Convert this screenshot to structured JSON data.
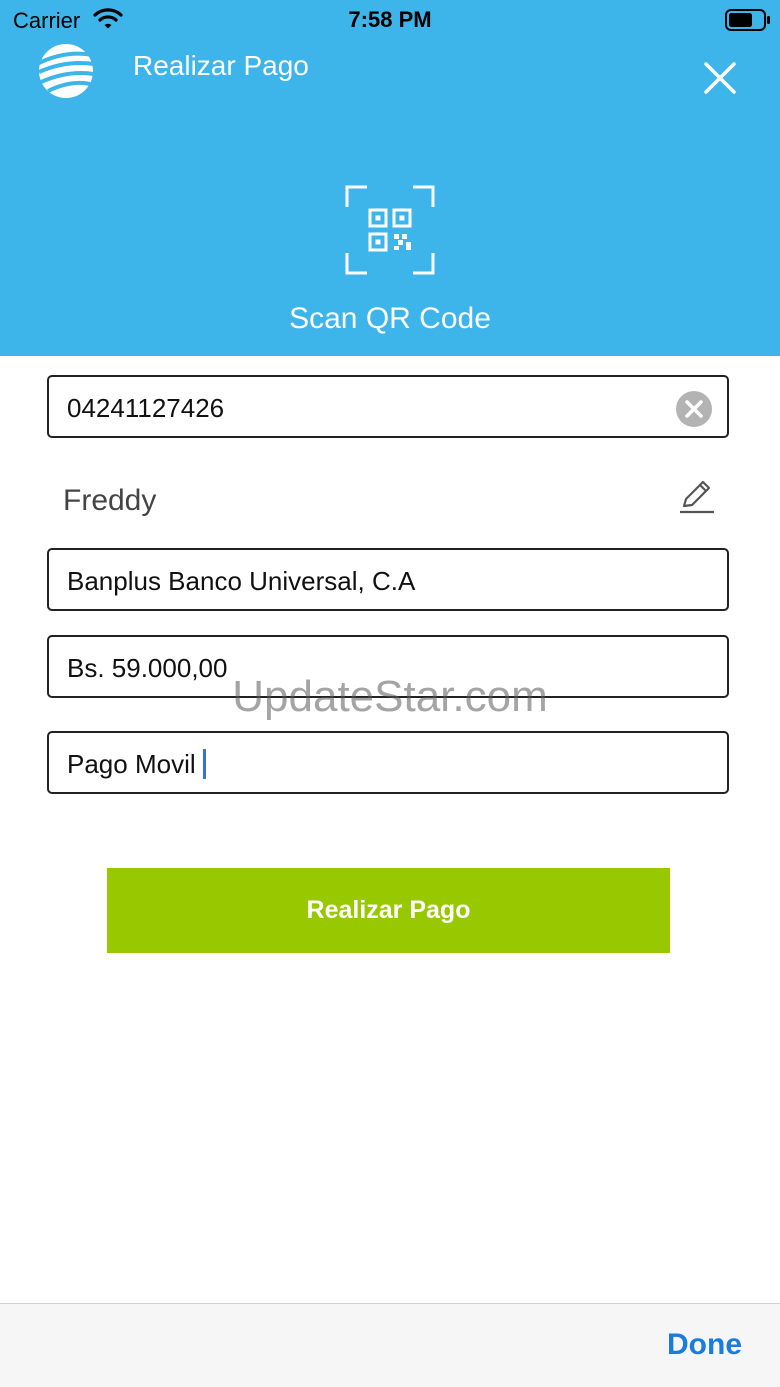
{
  "status_bar": {
    "carrier": "Carrier",
    "time": "7:58 PM",
    "icons": [
      "wifi-icon",
      "battery-icon"
    ]
  },
  "header": {
    "title": "Realizar Pago",
    "logo_icon": "bank-logo-icon",
    "close_icon": "close-icon",
    "scan_icon": "qr-scan-icon",
    "scan_label": "Scan QR Code",
    "background_color": "#3db4ea"
  },
  "form": {
    "phone": {
      "value": "04241127426",
      "clear_icon": "clear-circle-icon"
    },
    "recipient_name": "Freddy",
    "edit_icon": "pencil-icon",
    "bank": {
      "value": "Banplus Banco Universal, C.A"
    },
    "amount": {
      "value": "Bs. 59.000,00"
    },
    "concept": {
      "value": "Pago Movil"
    }
  },
  "watermark": "UpdateStar.com",
  "actions": {
    "pay_label": "Realizar Pago",
    "pay_color": "#97c800"
  },
  "keyboard_toolbar": {
    "done_label": "Done",
    "done_color": "#1a7be0"
  }
}
